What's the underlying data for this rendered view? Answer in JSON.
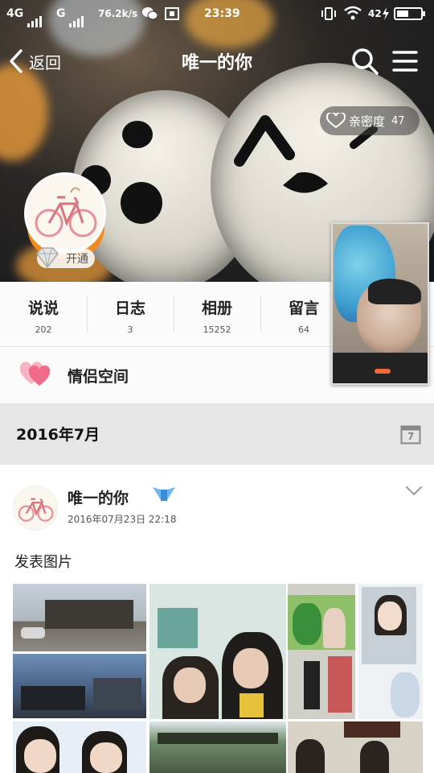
{
  "status_bar": {
    "network1": "4G",
    "network2": "G",
    "speed": "76.2k/s",
    "time": "23:39",
    "battery": "42"
  },
  "header": {
    "back_label": "返回",
    "title": "唯一的你",
    "intimacy_label": "亲密度",
    "intimacy_value": "47",
    "open_badge": "开通"
  },
  "stats": [
    {
      "label": "说说",
      "count": "202"
    },
    {
      "label": "日志",
      "count": "3"
    },
    {
      "label": "相册",
      "count": "15252"
    },
    {
      "label": "留言",
      "count": "64"
    }
  ],
  "couple_space": {
    "label": "情侣空间"
  },
  "month": {
    "label": "2016年7月",
    "calendar_day": "7"
  },
  "post": {
    "author": "唯一的你",
    "time": "2016年07月23日  22:18",
    "text": "发表图片"
  },
  "colors": {
    "accent_orange": "#f18b20",
    "heart_pink": "#f06a8a",
    "month_bar": "#e6e6e6"
  }
}
